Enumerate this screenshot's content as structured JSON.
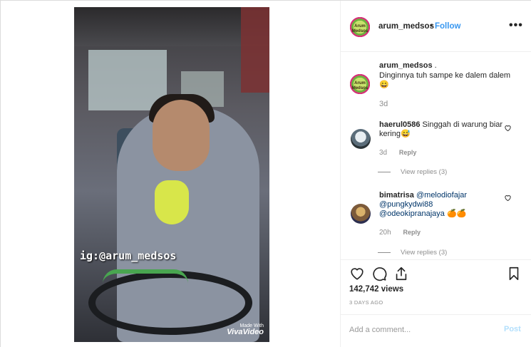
{
  "post": {
    "watermark": "ig:@arum_medsos",
    "video_badge_top": "Made With",
    "video_badge_brand": "VivaVideo"
  },
  "header": {
    "username": "arum_medsos",
    "separator": "•",
    "follow_label": "Follow",
    "more_label": "•••",
    "avatar_text": "Arum Medsos"
  },
  "caption": {
    "username": "arum_medsos",
    "suffix": ".",
    "text": "Dinginnya tuh sampe ke dalem dalem",
    "emoji": "😄",
    "time": "3d"
  },
  "comments": [
    {
      "username": "haerul0586",
      "text": "Singgah di warung biar kering",
      "emoji": "😅",
      "time": "3d",
      "reply_label": "Reply",
      "view_replies": "View replies (3)"
    },
    {
      "username": "bimatrisa",
      "mentions": [
        "@melodiofajar",
        "@pungkydwi88",
        "@odeokipranajaya"
      ],
      "emoji": "🍊🍊",
      "time": "20h",
      "reply_label": "Reply",
      "view_replies": "View replies (3)"
    }
  ],
  "actions": {
    "like_icon": "heart-icon",
    "comment_icon": "comment-icon",
    "share_icon": "share-icon",
    "save_icon": "bookmark-icon",
    "views": "142,742 views",
    "date": "3 DAYS AGO"
  },
  "add_comment": {
    "placeholder": "Add a comment...",
    "post_label": "Post"
  },
  "colors": {
    "link": "#3897f0",
    "post_disabled": "#b2dffc",
    "muted": "#8e8e8e",
    "text": "#262626"
  }
}
